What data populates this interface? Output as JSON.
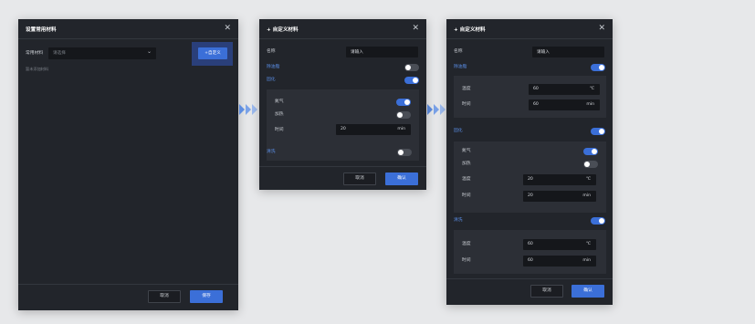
{
  "panel1": {
    "title": "设置常用材料",
    "close": "✕",
    "field_label": "常用材料",
    "select_placeholder": "请选择",
    "custom_button": "+自定义",
    "empty_hint": "暂未添加材料",
    "cancel": "取消",
    "save": "保存"
  },
  "panel2": {
    "title": "+ 自定义材料",
    "close": "✕",
    "name_label": "名称",
    "name_placeholder": "请输入",
    "degrease": "除油脂",
    "cure": "固化",
    "nitrogen": "氮气",
    "heating": "加热",
    "time": "时间",
    "time_value": "20",
    "time_unit": "min",
    "clean": "清洗",
    "cancel": "取消",
    "confirm": "确认"
  },
  "panel3": {
    "title": "+ 自定义材料",
    "close": "✕",
    "name_label": "名称",
    "name_placeholder": "请输入",
    "degrease": "除油脂",
    "temp": "温度",
    "temp_value": "60",
    "temp_unit": "℃",
    "time": "时间",
    "time_value": "60",
    "time_unit": "min",
    "cure": "固化",
    "nitrogen": "氮气",
    "heating": "加热",
    "cure_temp_value": "20",
    "cure_time_value": "20",
    "clean": "清洗",
    "clean_temp_value": "60",
    "clean_time_value": "60",
    "cancel": "取消",
    "confirm": "确认"
  },
  "toggles": {
    "p2_degrease": false,
    "p2_cure": true,
    "p2_nitrogen": true,
    "p2_heating": false,
    "p2_clean": false,
    "p3_degrease": true,
    "p3_cure": true,
    "p3_nitrogen": true,
    "p3_heating": false,
    "p3_clean": true
  },
  "colors": {
    "accent": "#3b6fd8",
    "panel": "#22252b",
    "background": "#e7e8ea"
  }
}
